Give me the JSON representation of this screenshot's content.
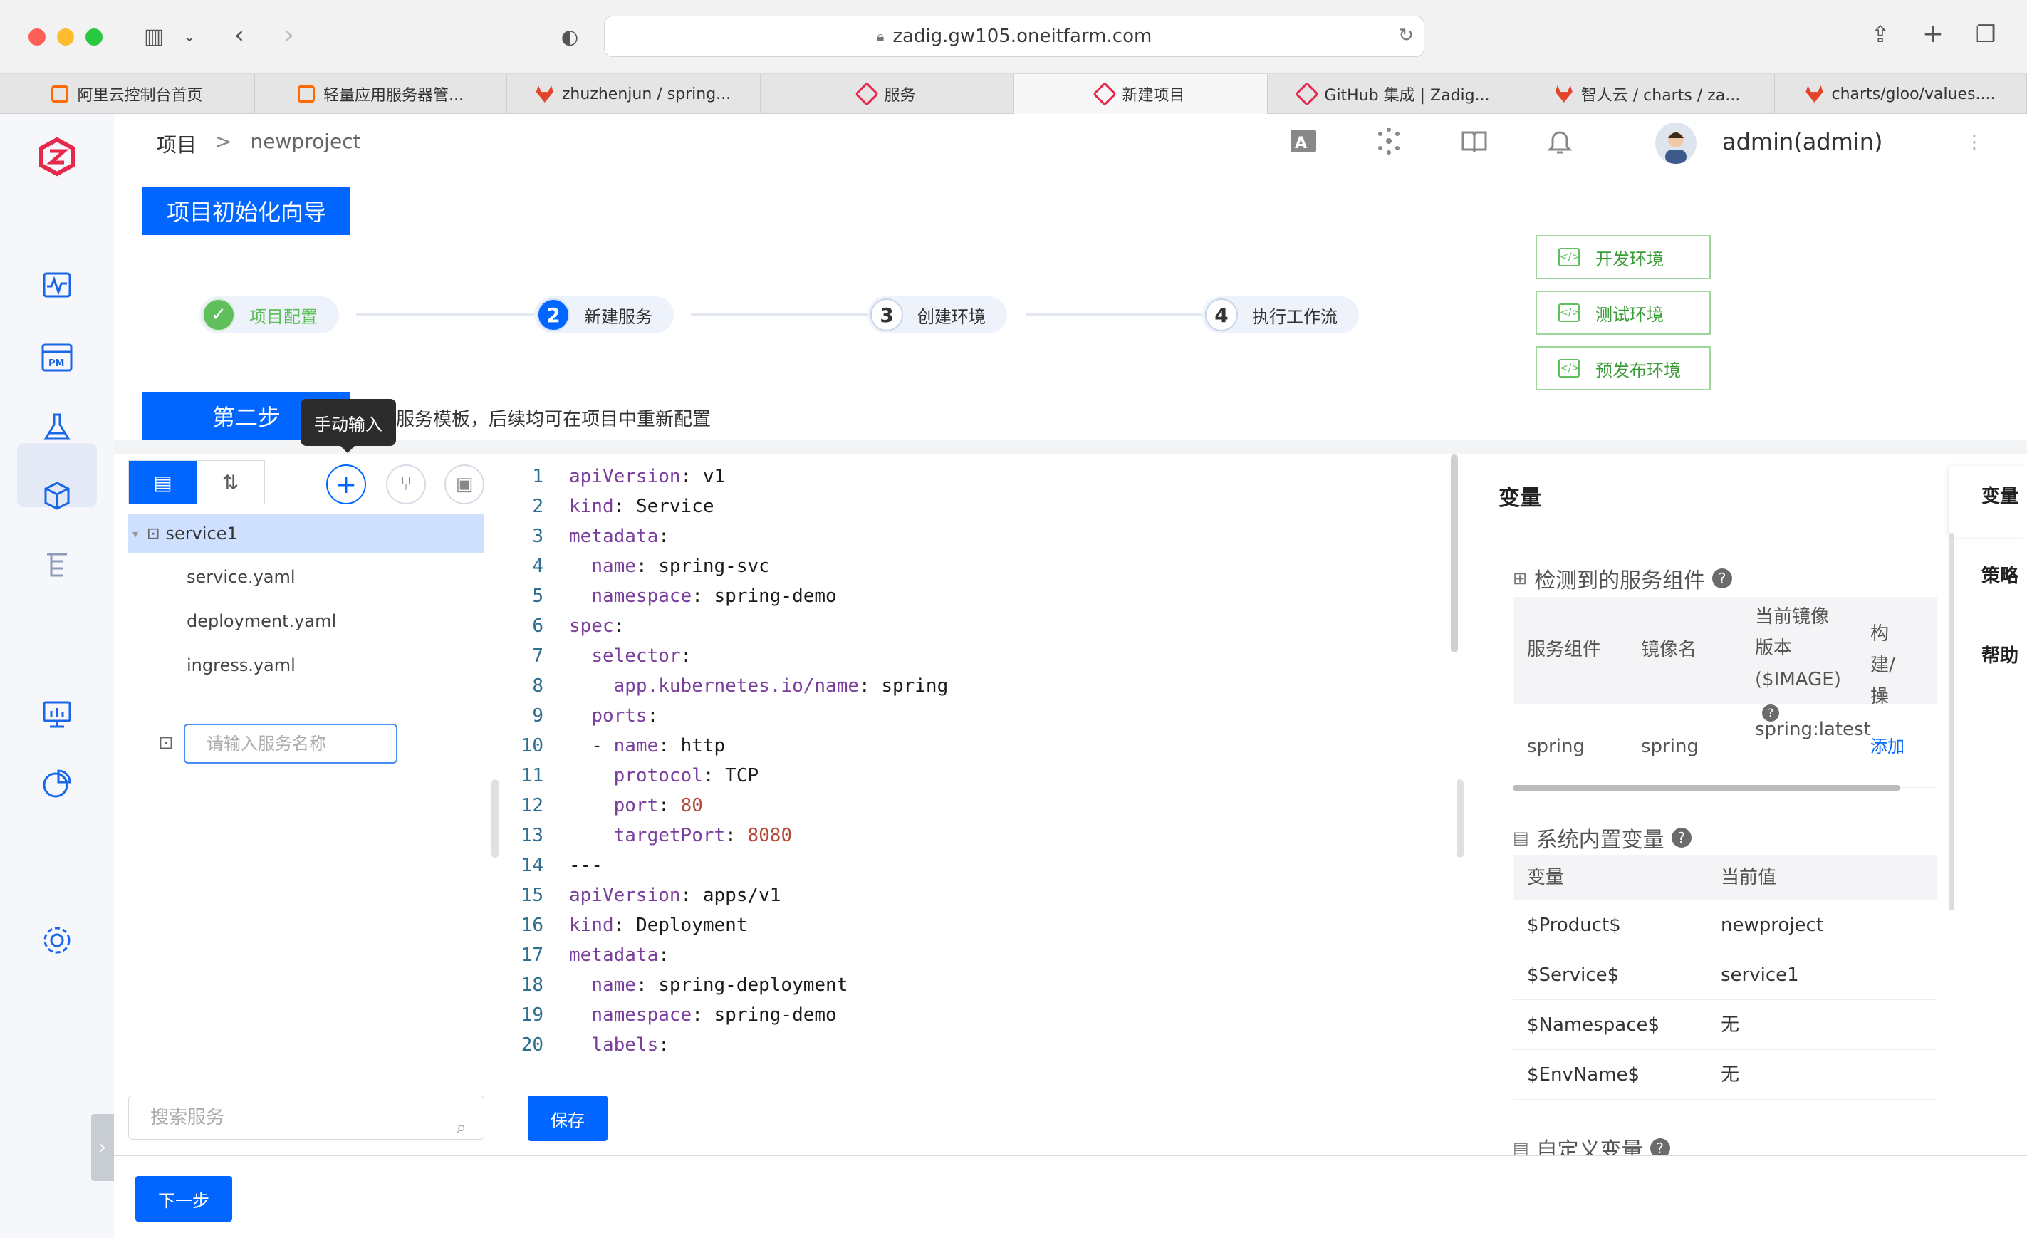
{
  "browser": {
    "url": "zadig.gw105.oneitfarm.com",
    "tabs": [
      {
        "label": "阿里云控制台首页",
        "icon": "aliyun-icon"
      },
      {
        "label": "轻量应用服务器管...",
        "icon": "aliyun-icon"
      },
      {
        "label": "zhuzhenjun / spring...",
        "icon": "gitlab-icon"
      },
      {
        "label": "服务",
        "icon": "zadig-icon"
      },
      {
        "label": "新建项目",
        "icon": "zadig-icon"
      },
      {
        "label": "GitHub 集成 | Zadig...",
        "icon": "zadig-icon"
      },
      {
        "label": "智人云 / charts / za...",
        "icon": "gitlab-icon"
      },
      {
        "label": "charts/gloo/values....",
        "icon": "gitlab-icon"
      }
    ]
  },
  "header": {
    "breadcrumb_root": "项目",
    "breadcrumb_sep": ">",
    "breadcrumb_current": "newproject",
    "user_name": "admin(admin)"
  },
  "wizard": {
    "title": "项目初始化向导",
    "steps": [
      {
        "num": "✓",
        "label": "项目配置",
        "state": "done"
      },
      {
        "num": "2",
        "label": "新建服务",
        "state": "current"
      },
      {
        "num": "3",
        "label": "创建环境",
        "state": "todo"
      },
      {
        "num": "4",
        "label": "执行工作流",
        "state": "todo"
      }
    ],
    "envs": [
      "开发环境",
      "测试环境",
      "预发布环境"
    ],
    "step_tag": "第二步",
    "step_desc": "服务模板，后续均可在项目中重新配置",
    "tooltip": "手动输入"
  },
  "tree": {
    "service_name": "service1",
    "files": [
      "service.yaml",
      "deployment.yaml",
      "ingress.yaml"
    ],
    "new_service_placeholder": "请输入服务名称",
    "search_placeholder": "搜索服务"
  },
  "editor": {
    "lines": [
      {
        "n": "1",
        "indent": "",
        "key": "apiVersion",
        "val": "v1"
      },
      {
        "n": "2",
        "indent": "",
        "key": "kind",
        "val": "Service"
      },
      {
        "n": "3",
        "indent": "",
        "key": "metadata",
        "val": ""
      },
      {
        "n": "4",
        "indent": "  ",
        "key": "name",
        "val": "spring-svc"
      },
      {
        "n": "5",
        "indent": "  ",
        "key": "namespace",
        "val": "spring-demo"
      },
      {
        "n": "6",
        "indent": "",
        "key": "spec",
        "val": ""
      },
      {
        "n": "7",
        "indent": "  ",
        "key": "selector",
        "val": ""
      },
      {
        "n": "8",
        "indent": "    ",
        "key": "app.kubernetes.io/name",
        "val": "spring"
      },
      {
        "n": "9",
        "indent": "  ",
        "key": "ports",
        "val": ""
      },
      {
        "n": "10",
        "indent": "  - ",
        "key": "name",
        "val": "http"
      },
      {
        "n": "11",
        "indent": "    ",
        "key": "protocol",
        "val": "TCP"
      },
      {
        "n": "12",
        "indent": "    ",
        "key": "port",
        "val": "80",
        "num": true
      },
      {
        "n": "13",
        "indent": "    ",
        "key": "targetPort",
        "val": "8080",
        "num": true
      },
      {
        "n": "14",
        "indent": "",
        "key": "",
        "val": "---"
      },
      {
        "n": "15",
        "indent": "",
        "key": "apiVersion",
        "val": "apps/v1"
      },
      {
        "n": "16",
        "indent": "",
        "key": "kind",
        "val": "Deployment"
      },
      {
        "n": "17",
        "indent": "",
        "key": "metadata",
        "val": ""
      },
      {
        "n": "18",
        "indent": "  ",
        "key": "name",
        "val": "spring-deployment"
      },
      {
        "n": "19",
        "indent": "  ",
        "key": "namespace",
        "val": "spring-demo"
      },
      {
        "n": "20",
        "indent": "  ",
        "key": "labels",
        "val": ""
      }
    ],
    "save_label": "保存"
  },
  "variables": {
    "title": "变量",
    "detected_title": "检测到的服务组件",
    "comp_headers": [
      "服务组件",
      "镜像名",
      "当前镜像版本($IMAGE)",
      "构建/操"
    ],
    "comp_row": {
      "component": "spring",
      "image": "spring",
      "version": "spring:latest",
      "action": "添加"
    },
    "system_title": "系统内置变量",
    "sys_headers": [
      "变量",
      "当前值"
    ],
    "sys_rows": [
      {
        "name": "$Product$",
        "value": "newproject"
      },
      {
        "name": "$Service$",
        "value": "service1"
      },
      {
        "name": "$Namespace$",
        "value": "无"
      },
      {
        "name": "$EnvName$",
        "value": "无"
      }
    ],
    "custom_title": "自定义变量"
  },
  "right_tabs": [
    "变量",
    "策略",
    "帮助"
  ],
  "footer": {
    "next_label": "下一步"
  }
}
